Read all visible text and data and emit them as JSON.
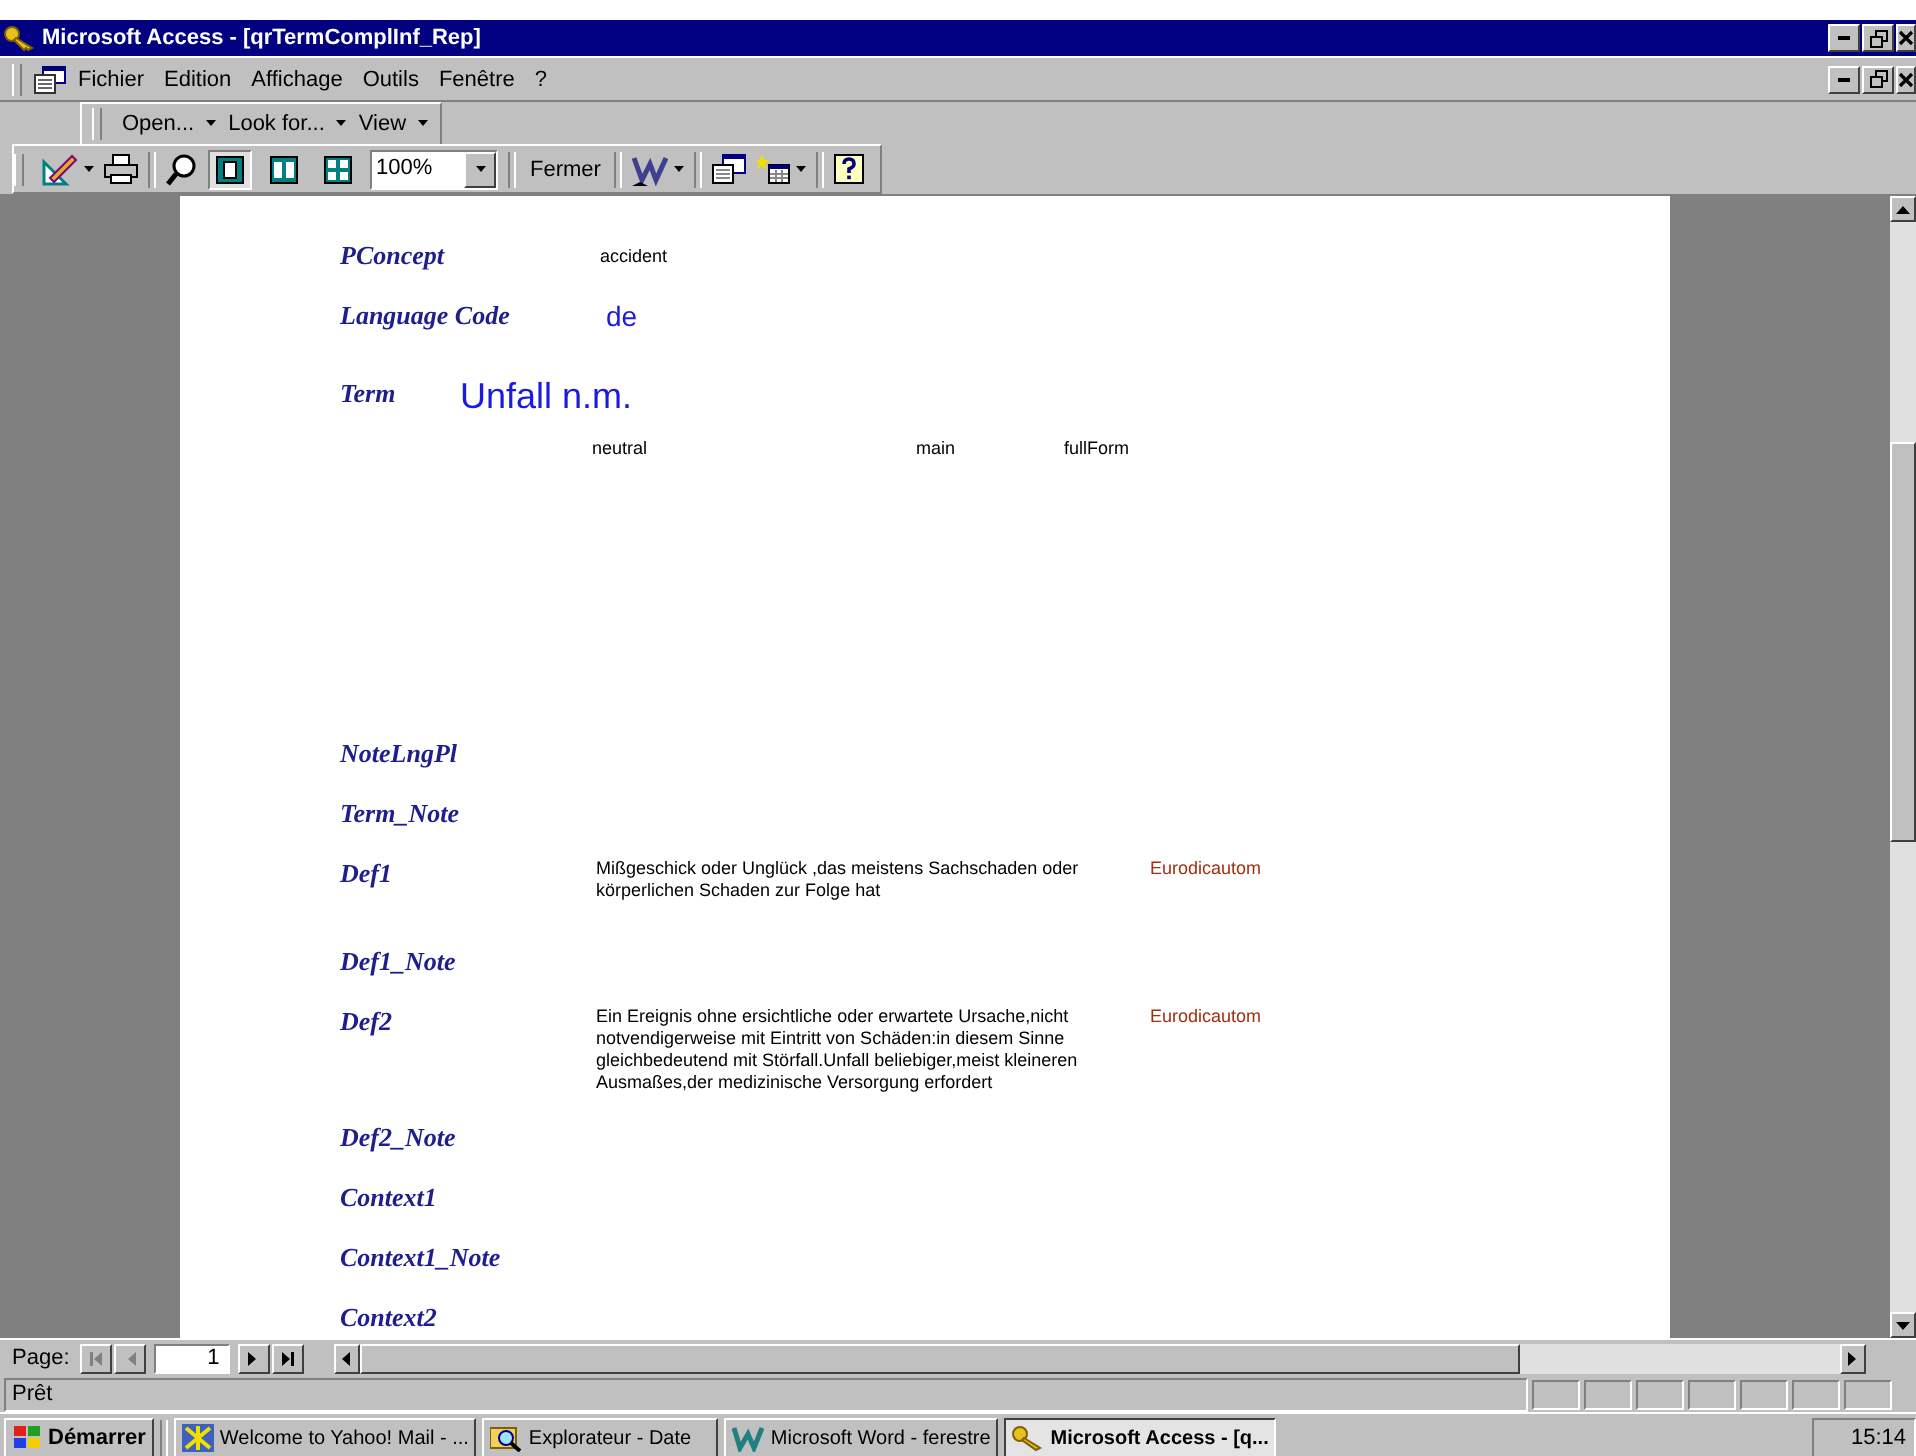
{
  "window": {
    "title": "Microsoft Access - [qrTermComplInf_Rep]"
  },
  "menu": [
    "Fichier",
    "Edition",
    "Affichage",
    "Outils",
    "Fenêtre",
    "?"
  ],
  "web_toolbar": [
    "Open...",
    "Look for...",
    "View"
  ],
  "preview_toolbar": {
    "view_buttons": [
      {
        "selected": true
      },
      {
        "selected": false
      },
      {
        "selected": false
      }
    ],
    "zoom": "100%",
    "close_label": "Fermer"
  },
  "report": {
    "fields": [
      {
        "label": "PConcept",
        "kind": "value",
        "value": "accident"
      },
      {
        "label": "Language Code",
        "kind": "code",
        "value": "de"
      },
      {
        "label": "Term",
        "kind": "term",
        "value": "Unfall n.m.",
        "attributes": [
          "neutral",
          "main",
          "fullForm"
        ]
      },
      {
        "label": "NoteLngPl",
        "kind": "empty"
      },
      {
        "label": "Term_Note",
        "kind": "empty"
      },
      {
        "label": "Def1",
        "kind": "definition",
        "value": "Mißgeschick oder Unglück ,das meistens Sachschaden oder körperlichen Schaden zur Folge hat",
        "source": "Eurodicautom"
      },
      {
        "label": "Def1_Note",
        "kind": "empty"
      },
      {
        "label": "Def2",
        "kind": "definition",
        "value": "Ein Ereignis ohne ersichtliche oder erwartete Ursache,nicht notvendigerweise mit Eintritt von Schäden:in diesem Sinne gleichbedeutend mit Störfall.Unfall beliebiger,meist kleineren Ausmaßes,der medizinische Versorgung erfordert",
        "source": "Eurodicautom"
      },
      {
        "label": "Def2_Note",
        "kind": "empty"
      },
      {
        "label": "Context1",
        "kind": "empty"
      },
      {
        "label": "Context1_Note",
        "kind": "empty"
      },
      {
        "label": "Context2",
        "kind": "empty"
      }
    ]
  },
  "navigation": {
    "label": "Page:",
    "page": "1",
    "buttons": [
      {
        "disabled": true
      },
      {
        "disabled": true
      },
      {
        "disabled": false
      },
      {
        "disabled": false
      }
    ]
  },
  "status_bar": {
    "text": "Prêt"
  },
  "taskbar": {
    "start": "Démarrer",
    "tasks": [
      {
        "label": "Welcome to Yahoo! Mail - ...",
        "selected": false
      },
      {
        "label": "Explorateur - Date",
        "selected": false
      },
      {
        "label": "Microsoft Word - ferestre",
        "selected": false
      },
      {
        "label": "Microsoft Access - [q...",
        "selected": true
      }
    ],
    "clock": "15:14"
  }
}
